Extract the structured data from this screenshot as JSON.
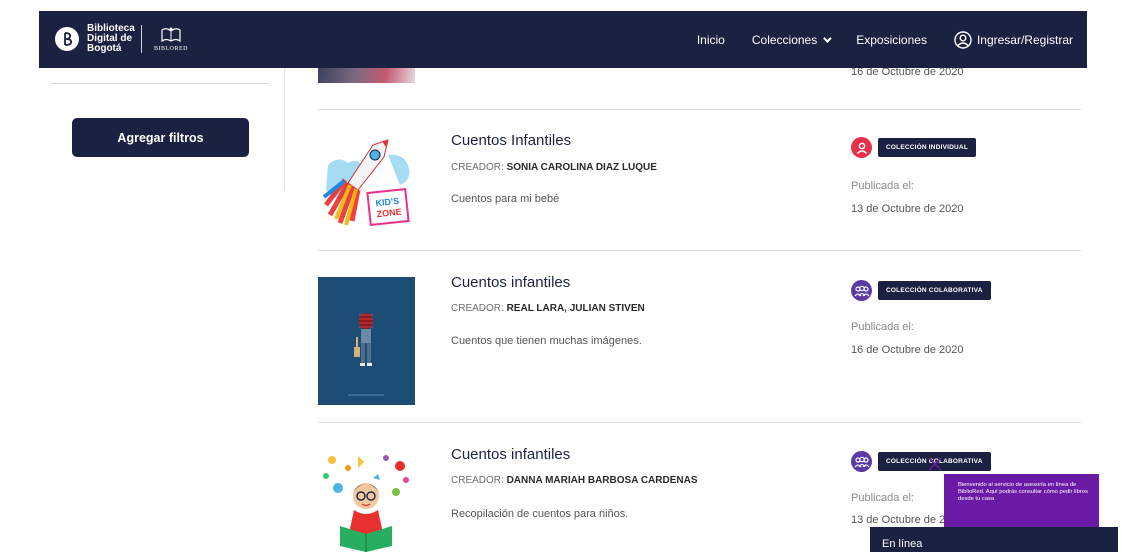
{
  "header": {
    "brand_text": "Biblioteca Digital de Bogotá",
    "brand_line1": "Biblioteca",
    "brand_line2": "Digital de",
    "brand_line3": "Bogotá",
    "brand2_text": "BIBLORED",
    "nav": {
      "home": "Inicio",
      "collections": "Colecciones",
      "exhibitions": "Exposiciones",
      "login": "Ingresar/Registrar"
    }
  },
  "sidebar": {
    "filter_button": "Agregar filtros"
  },
  "top_partial": {
    "date": "16 de Octubre de 2020"
  },
  "results": [
    {
      "title": "Cuentos Infantiles",
      "creator_label": "CREADOR:",
      "creator_name": "SONIA CAROLINA DIAZ LUQUE",
      "description": "Cuentos para mi bebé",
      "badge": "COLECCIÓN INDIVIDUAL",
      "published_label": "Publicada el:",
      "published_date": "13 de Octubre de 2020",
      "thumb_text_1": "KID'S",
      "thumb_text_2": "ZONE"
    },
    {
      "title": "Cuentos infantiles",
      "creator_label": "CREADOR:",
      "creator_name": "REAL LARA, JULIAN STIVEN",
      "description": "Cuentos que tienen muchas imágenes.",
      "badge": "COLECCIÓN COLABORATIVA",
      "published_label": "Publicada el:",
      "published_date": "16 de Octubre de 2020"
    },
    {
      "title": "Cuentos infantiles",
      "creator_label": "CREADOR:",
      "creator_name": "DANNA MARIAH BARBOSA CARDENAS",
      "description": "Recopilación de cuentos para niños.",
      "badge": "COLECCIÓN COLABORATIVA",
      "published_label": "Publicada el:",
      "published_date": "13 de Octubre de 2020"
    }
  ],
  "chat": {
    "message": "Bienvenido al servicio de asesoría en línea de BiblioRed. Aquí podrás consultar cómo pedir libros desde tu casa",
    "status": "En línea"
  },
  "colors": {
    "navy": "#1b2140",
    "individual_icon": "#e8304a",
    "collab_icon": "#5b3aa6",
    "chat_purple": "#6a1aa4"
  }
}
